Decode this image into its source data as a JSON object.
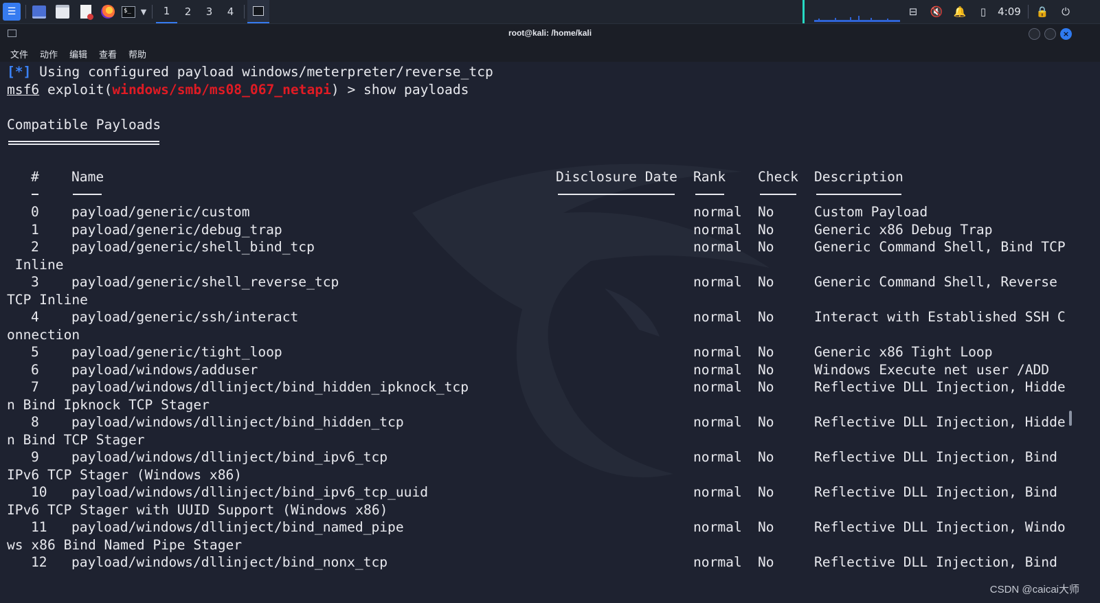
{
  "panel": {
    "workspaces": [
      "1",
      "2",
      "3",
      "4"
    ],
    "clock": "4:09",
    "icons": [
      "kali-menu-icon",
      "desktop-icon",
      "file-manager-icon",
      "text-editor-icon",
      "firefox-icon",
      "terminal-icon",
      "chevron-down-icon",
      "terminal-task-icon",
      "network-icon",
      "mute-icon",
      "bell-icon",
      "battery-icon",
      "lock-icon",
      "logout-icon"
    ],
    "accent": "#367bf0"
  },
  "window": {
    "title": "root@kali: /home/kali"
  },
  "menu": [
    "文件",
    "动作",
    "编辑",
    "查看",
    "帮助"
  ],
  "terminal": {
    "info_tag": "[*]",
    "info_text": " Using configured payload windows/meterpreter/reverse_tcp",
    "prompt_msf": "msf6",
    "prompt_exploit_open": " exploit(",
    "prompt_module": "windows/smb/ms08_067_netapi",
    "prompt_close": ") > show payloads",
    "section_title": "Compatible Payloads",
    "headers": {
      "num": "#",
      "name": "Name",
      "date": "Disclosure Date",
      "rank": "Rank",
      "check": "Check",
      "desc": "Description"
    },
    "rows": [
      {
        "num": "0",
        "name": "payload/generic/custom",
        "rank": "normal",
        "check": "No",
        "desc": "Custom Payload",
        "wrap": ""
      },
      {
        "num": "1",
        "name": "payload/generic/debug_trap",
        "rank": "normal",
        "check": "No",
        "desc": "Generic x86 Debug Trap",
        "wrap": ""
      },
      {
        "num": "2",
        "name": "payload/generic/shell_bind_tcp",
        "rank": "normal",
        "check": "No",
        "desc": "Generic Command Shell, Bind TCP",
        "wrap": " Inline"
      },
      {
        "num": "3",
        "name": "payload/generic/shell_reverse_tcp",
        "rank": "normal",
        "check": "No",
        "desc": "Generic Command Shell, Reverse",
        "wrap": "TCP Inline"
      },
      {
        "num": "4",
        "name": "payload/generic/ssh/interact",
        "rank": "normal",
        "check": "No",
        "desc": "Interact with Established SSH C",
        "wrap": "onnection"
      },
      {
        "num": "5",
        "name": "payload/generic/tight_loop",
        "rank": "normal",
        "check": "No",
        "desc": "Generic x86 Tight Loop",
        "wrap": ""
      },
      {
        "num": "6",
        "name": "payload/windows/adduser",
        "rank": "normal",
        "check": "No",
        "desc": "Windows Execute net user /ADD",
        "wrap": ""
      },
      {
        "num": "7",
        "name": "payload/windows/dllinject/bind_hidden_ipknock_tcp",
        "rank": "normal",
        "check": "No",
        "desc": "Reflective DLL Injection, Hidde",
        "wrap": "n Bind Ipknock TCP Stager"
      },
      {
        "num": "8",
        "name": "payload/windows/dllinject/bind_hidden_tcp",
        "rank": "normal",
        "check": "No",
        "desc": "Reflective DLL Injection, Hidde",
        "wrap": "n Bind TCP Stager"
      },
      {
        "num": "9",
        "name": "payload/windows/dllinject/bind_ipv6_tcp",
        "rank": "normal",
        "check": "No",
        "desc": "Reflective DLL Injection, Bind",
        "wrap": "IPv6 TCP Stager (Windows x86)"
      },
      {
        "num": "10",
        "name": "payload/windows/dllinject/bind_ipv6_tcp_uuid",
        "rank": "normal",
        "check": "No",
        "desc": "Reflective DLL Injection, Bind",
        "wrap": "IPv6 TCP Stager with UUID Support (Windows x86)"
      },
      {
        "num": "11",
        "name": "payload/windows/dllinject/bind_named_pipe",
        "rank": "normal",
        "check": "No",
        "desc": "Reflective DLL Injection, Windo",
        "wrap": "ws x86 Bind Named Pipe Stager"
      },
      {
        "num": "12",
        "name": "payload/windows/dllinject/bind_nonx_tcp",
        "rank": "normal",
        "check": "No",
        "desc": "Reflective DLL Injection, Bind",
        "wrap": ""
      }
    ],
    "colors": {
      "info": "#3b82f6",
      "module": "#e01b24",
      "text": "#e8e9ee"
    }
  },
  "watermark": "CSDN @caicai大师"
}
